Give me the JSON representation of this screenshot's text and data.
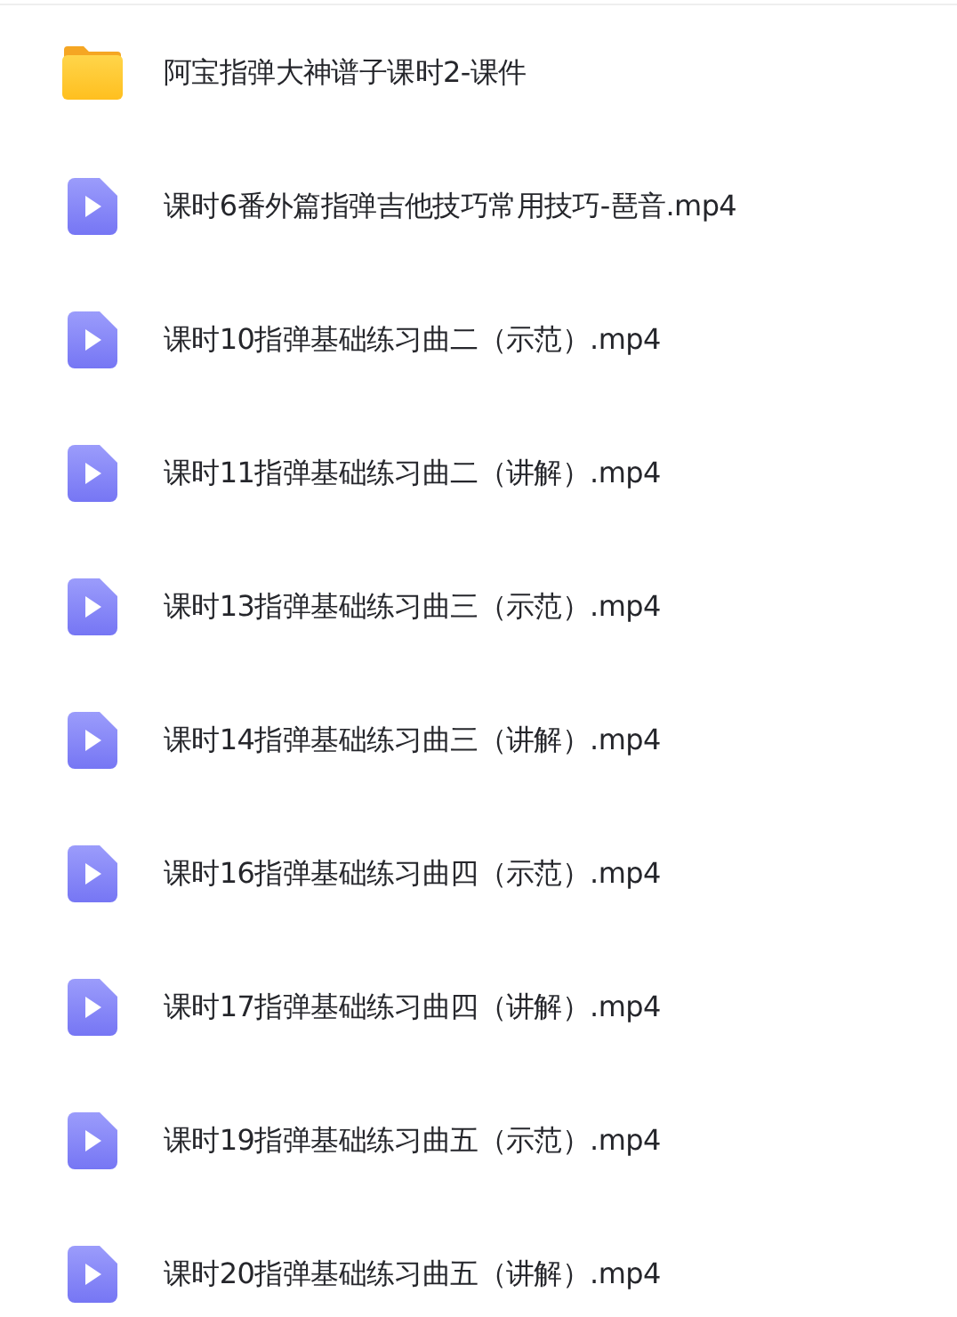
{
  "files": [
    {
      "kind": "folder",
      "name": "阿宝指弹大神谱子课时2-课件"
    },
    {
      "kind": "video",
      "name": "课时6番外篇指弹吉他技巧常用技巧-琶音.mp4"
    },
    {
      "kind": "video",
      "name": "课时10指弹基础练习曲二（示范）.mp4"
    },
    {
      "kind": "video",
      "name": "课时11指弹基础练习曲二（讲解）.mp4"
    },
    {
      "kind": "video",
      "name": "课时13指弹基础练习曲三（示范）.mp4"
    },
    {
      "kind": "video",
      "name": "课时14指弹基础练习曲三（讲解）.mp4"
    },
    {
      "kind": "video",
      "name": "课时16指弹基础练习曲四（示范）.mp4"
    },
    {
      "kind": "video",
      "name": "课时17指弹基础练习曲四（讲解）.mp4"
    },
    {
      "kind": "video",
      "name": "课时19指弹基础练习曲五（示范）.mp4"
    },
    {
      "kind": "video",
      "name": "课时20指弹基础练习曲五（讲解）.mp4"
    }
  ]
}
